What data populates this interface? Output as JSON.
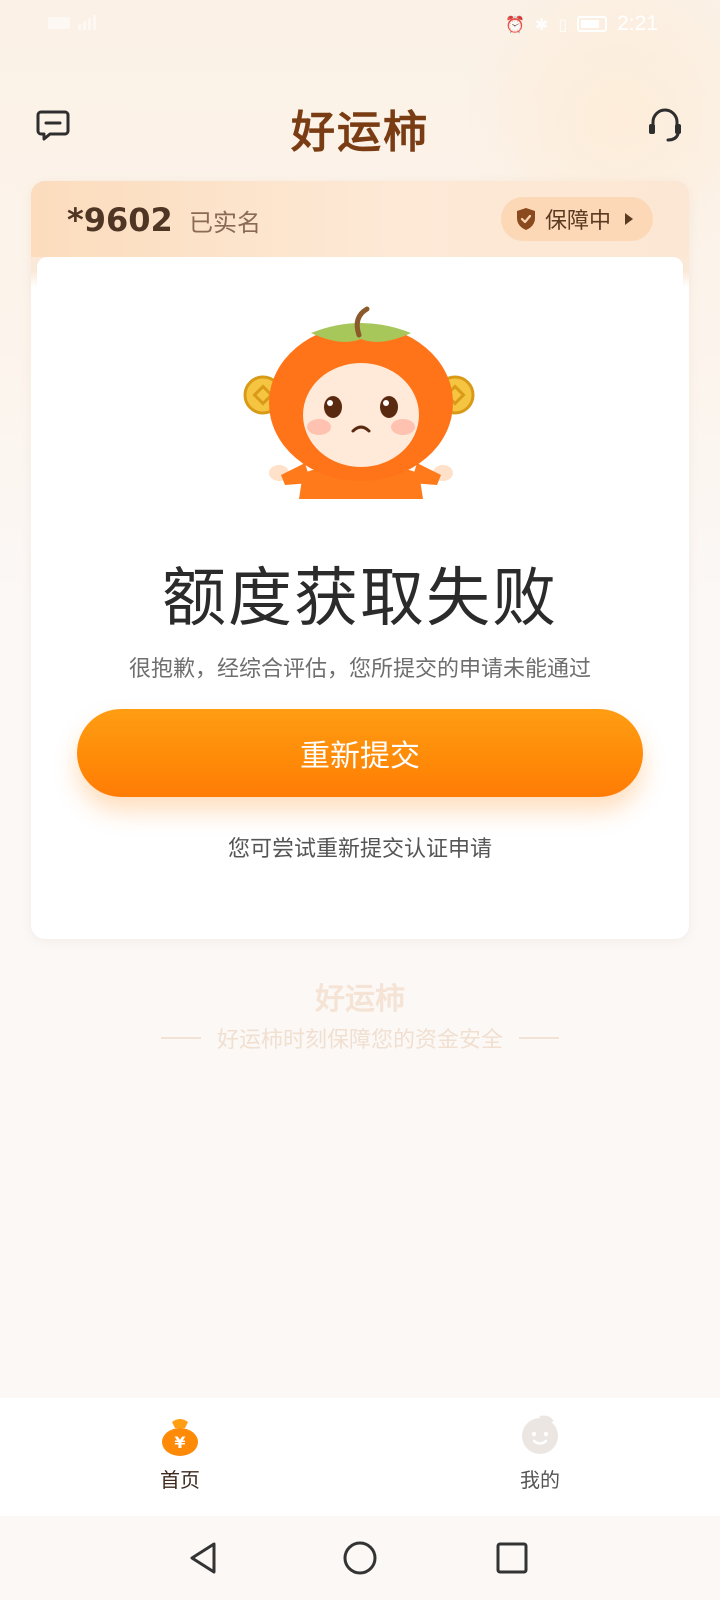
{
  "status_bar": {
    "time": "2:21",
    "icons": [
      "alarm-icon",
      "bluetooth-icon",
      "vibrate-icon",
      "battery-icon",
      "signal-icon"
    ]
  },
  "header": {
    "title": "好运柿",
    "left_icon": "message-icon",
    "right_icon": "customer-service-icon"
  },
  "account": {
    "masked_number": "*9602",
    "verified_label": "已实名",
    "protection_label": "保障中"
  },
  "result": {
    "title": "额度获取失败",
    "description": "很抱歉，经综合评估，您所提交的申请未能通过",
    "button_label": "重新提交",
    "hint": "您可尝试重新提交认证申请"
  },
  "brand": {
    "title": "好运柿",
    "slogan": "好运柿时刻保障您的资金安全"
  },
  "bottom_nav": {
    "items": [
      {
        "label": "首页",
        "icon": "money-bag-icon",
        "active": true
      },
      {
        "label": "我的",
        "icon": "profile-icon",
        "active": false
      }
    ]
  },
  "system_nav": [
    "back-icon",
    "home-icon",
    "recents-icon"
  ],
  "colors": {
    "accent": "#ff8a08",
    "title_brown": "#7a3c12"
  }
}
